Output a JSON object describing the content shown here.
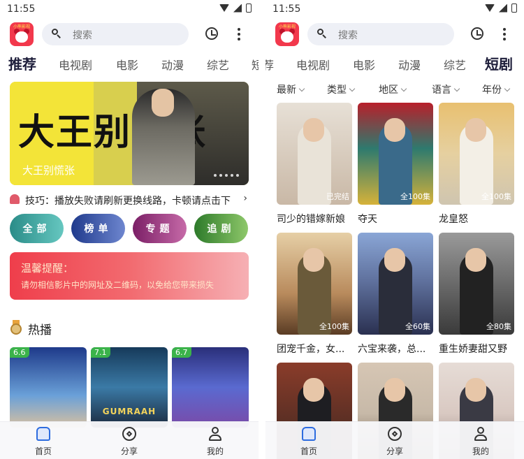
{
  "left": {
    "status": {
      "time": "11:55"
    },
    "app_logo_text": "小熊影视",
    "search": {
      "placeholder": "搜索"
    },
    "tabs": [
      "推荐",
      "电视剧",
      "电影",
      "动漫",
      "综艺",
      "短"
    ],
    "active_tab": "推荐",
    "banner": {
      "caption": "大王别慌张",
      "calligraphy": "大王别慌张"
    },
    "tip": {
      "text": "技巧：播放失败请刷新更换线路，卡顿请点击下",
      "arrow": "›"
    },
    "categories": [
      {
        "label": "全部",
        "color": "#3aa9a4"
      },
      {
        "label": "榜单",
        "color": "#2e4aa6"
      },
      {
        "label": "专题",
        "color": "#9d2e7a"
      },
      {
        "label": "追剧",
        "color": "#3e8b3a"
      }
    ],
    "notice": {
      "title": "温馨提醒：",
      "body": "请勿相信影片中的网址及二维码，以免给您带来损失"
    },
    "section": {
      "title": "热播"
    },
    "hot": [
      {
        "score": "6.6",
        "title": "",
        "color": "#1c3a8c"
      },
      {
        "score": "7.1",
        "title": "GUMRAAH",
        "color": "#2a5f8a"
      },
      {
        "score": "6.7",
        "title": "",
        "color": "#3b4aa3"
      }
    ]
  },
  "right": {
    "status": {
      "time": "11:55"
    },
    "app_logo_text": "小熊影视",
    "search": {
      "placeholder": "搜索"
    },
    "tabs": [
      "荐",
      "电视剧",
      "电影",
      "动漫",
      "综艺",
      "短剧"
    ],
    "active_tab": "短剧",
    "filters": [
      "最新",
      "类型",
      "地区",
      "语言",
      "年份"
    ],
    "dramas": [
      {
        "title": "司少的错嫁新娘",
        "badge": "已完结",
        "color": "#c9b8a6"
      },
      {
        "title": "夺天",
        "badge": "全100集",
        "color": "#2e7a6e"
      },
      {
        "title": "龙皇怒",
        "badge": "全100集",
        "color": "#e6d0a0"
      },
      {
        "title": "团宠千金，女...",
        "badge": "全100集",
        "color": "#b88a5c"
      },
      {
        "title": "六宝来袭，总...",
        "badge": "全60集",
        "color": "#5d6e9a"
      },
      {
        "title": "重生娇妻甜又野",
        "badge": "全80集",
        "color": "#6a6a6a"
      },
      {
        "title": "",
        "badge": "",
        "color": "#8a3c2a"
      },
      {
        "title": "",
        "badge": "",
        "color": "#c7b9a8"
      },
      {
        "title": "",
        "badge": "",
        "color": "#d9c9c2"
      }
    ]
  },
  "nav": [
    "首页",
    "分享",
    "我的"
  ],
  "colors": {
    "accent": "#2d6cdf",
    "score": "#3bb34a",
    "notice": "#ef3e4b",
    "tab_active": "#1d1d3a"
  }
}
